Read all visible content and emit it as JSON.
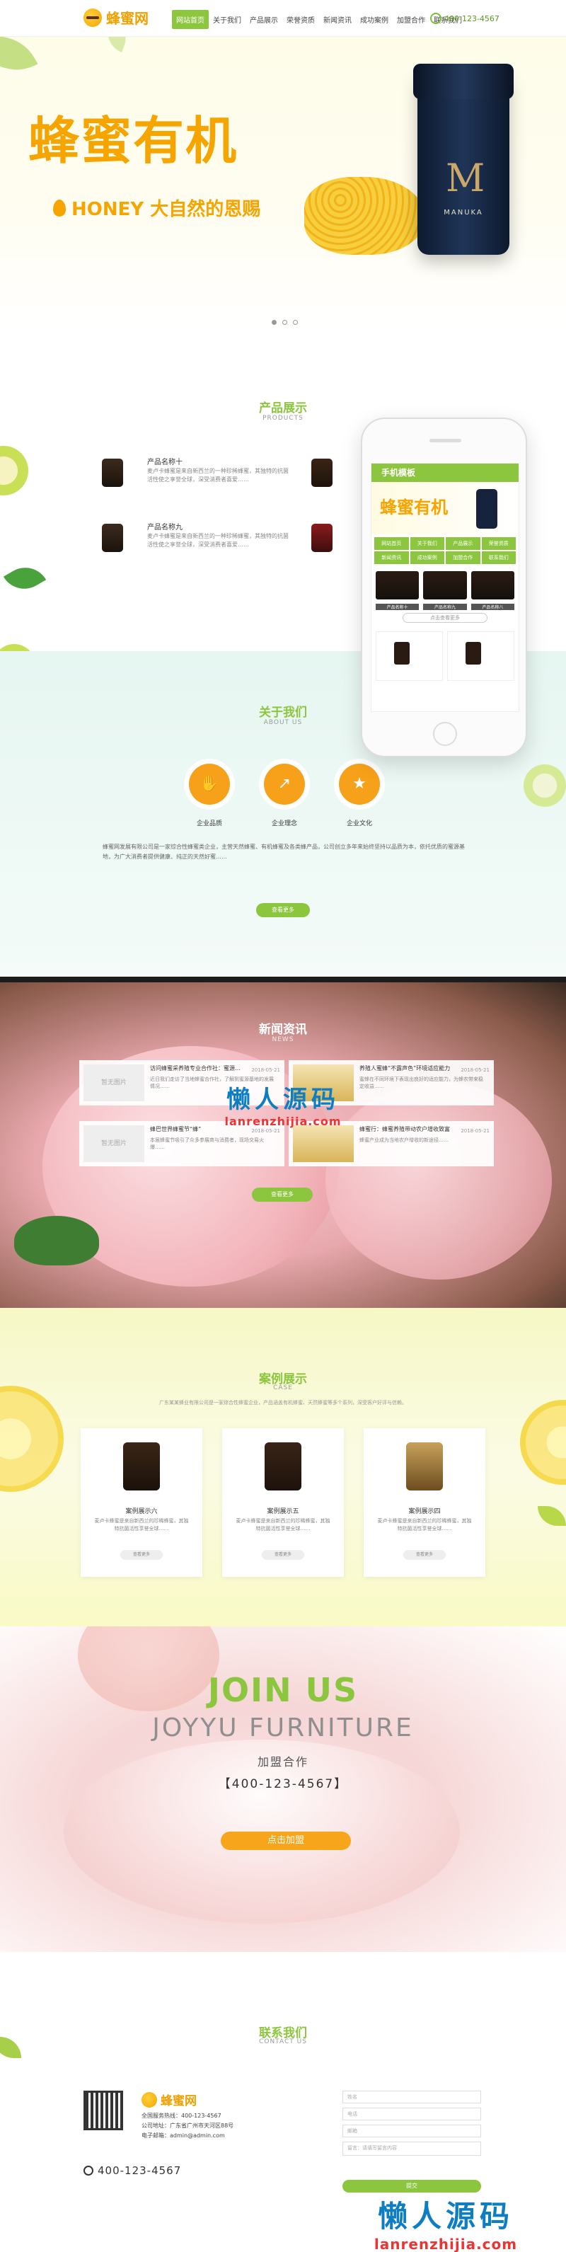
{
  "header": {
    "logo_text": "蜂蜜网",
    "nav": [
      "网站首页",
      "关于我们",
      "产品展示",
      "荣誉资质",
      "新闻资讯",
      "成功案例",
      "加盟合作",
      "联系我们"
    ],
    "hotline": "400-123-4567"
  },
  "hero": {
    "title": "蜂蜜有机",
    "subtitle": "HONEY 大自然的恩赐",
    "jar_letter": "M",
    "jar_label": "MANUKA"
  },
  "products": {
    "title": "产品展示",
    "title_en": "PRODUCTS",
    "items": [
      {
        "name": "产品名称十",
        "desc": "麦卢卡蜂蜜是来自新西兰的一种珍稀蜂蜜，其独特的抗菌活性使之享誉全球，深受消费者喜爱……"
      },
      {
        "name": "产品名称九",
        "desc": "麦卢卡蜂蜜是来自新西兰的一种珍稀蜂蜜，其独特的抗菌活性使之享誉全球，深受消费者喜爱……"
      }
    ]
  },
  "phone": {
    "bar_title": "手机模板",
    "banner_text": "蜂蜜有机",
    "menu": [
      "网站首页",
      "关于我们",
      "产品展示",
      "荣誉资质",
      "新闻资讯",
      "成功案例",
      "加盟合作",
      "联系我们"
    ],
    "products": [
      "产品名称十",
      "产品名称九",
      "产品名称八"
    ],
    "more_label": "点击查看更多"
  },
  "about": {
    "title": "关于我们",
    "title_en": "ABOUT US",
    "icons": [
      {
        "icon": "handshake-icon",
        "label": "企业品质"
      },
      {
        "icon": "growth-chart-icon",
        "label": "企业理念"
      },
      {
        "icon": "medal-icon",
        "label": "企业文化"
      }
    ],
    "text": "蜂蜜网发展有限公司是一家综合性蜂蜜类企业，主营天然蜂蜜、有机蜂蜜及各类蜂产品，公司创立多年来始终坚持以品质为本，依托优质的蜜源基地，为广大消费者提供健康、纯正的天然好蜜……",
    "more_label": "查看更多"
  },
  "news": {
    "title": "新闻资讯",
    "title_en": "NEWS",
    "items": [
      {
        "title": "访问蜂蜜采养殖专业合作社：蜜源发展前景",
        "date": "2018-05-21",
        "img": "暂无图片",
        "desc": "近日我们走访了当地蜂蜜合作社，了解到蜜源基地的发展情况……"
      },
      {
        "title": "养殖人蜜蜂“不露声色”环境适应能力",
        "date": "2018-05-21",
        "img": "",
        "desc": "蜜蜂在不同环境下表现出良好的适应能力，为蜂农带来稳定收益……"
      },
      {
        "title": "蜂巴世界蜂蜜节“蜂”",
        "date": "2018-05-21",
        "img": "暂无图片",
        "desc": "本届蜂蜜节吸引了众多参展商与消费者，现场交易火爆……"
      },
      {
        "title": "蜂蜜行：蜂蜜养殖带动农户增收致富",
        "date": "2018-05-21",
        "img": "",
        "desc": "蜂蜜产业成为当地农户增收的新途径……"
      }
    ],
    "more_label": "查看更多",
    "watermark_cn": "懒人源码",
    "watermark_en": "lanrenzhijia.com"
  },
  "cases": {
    "title": "案例展示",
    "title_en": "CASE",
    "desc": "广东某某蜂业有限公司是一家综合性蜂蜜企业，产品涵盖有机蜂蜜、天然蜂蜜等多个系列，深受客户好评与信赖。",
    "items": [
      {
        "name": "案例展示六",
        "desc": "麦卢卡蜂蜜是来自新西兰的珍稀蜂蜜，其独特抗菌活性享誉全球……",
        "btn": "查看更多"
      },
      {
        "name": "案例展示五",
        "desc": "麦卢卡蜂蜜是来自新西兰的珍稀蜂蜜，其独特抗菌活性享誉全球……",
        "btn": "查看更多"
      },
      {
        "name": "案例展示四",
        "desc": "麦卢卡蜂蜜是来自新西兰的珍稀蜂蜜，其独特抗菌活性享誉全球……",
        "btn": "查看更多"
      }
    ]
  },
  "join": {
    "title": "JOIN US",
    "title_en": "JOYYU FURNITURE",
    "subtitle": "加盟合作",
    "phone": "【400-123-4567】",
    "button": "点击加盟"
  },
  "contact": {
    "title": "联系我们",
    "title_en": "CONTACT US",
    "logo_text": "蜂蜜网",
    "lines": [
      "全国服务热线：400-123-4567",
      "公司地址：广东省广州市天河区88号",
      "电子邮箱：admin@admin.com"
    ],
    "hotline": "400-123-4567",
    "form": {
      "name_placeholder": "姓名",
      "phone_placeholder": "电话",
      "email_placeholder": "邮箱",
      "message_placeholder": "留言：请填写留言内容",
      "submit": "提交"
    },
    "watermark_cn": "懒人源码",
    "watermark_en": "lanrenzhijia.com"
  }
}
